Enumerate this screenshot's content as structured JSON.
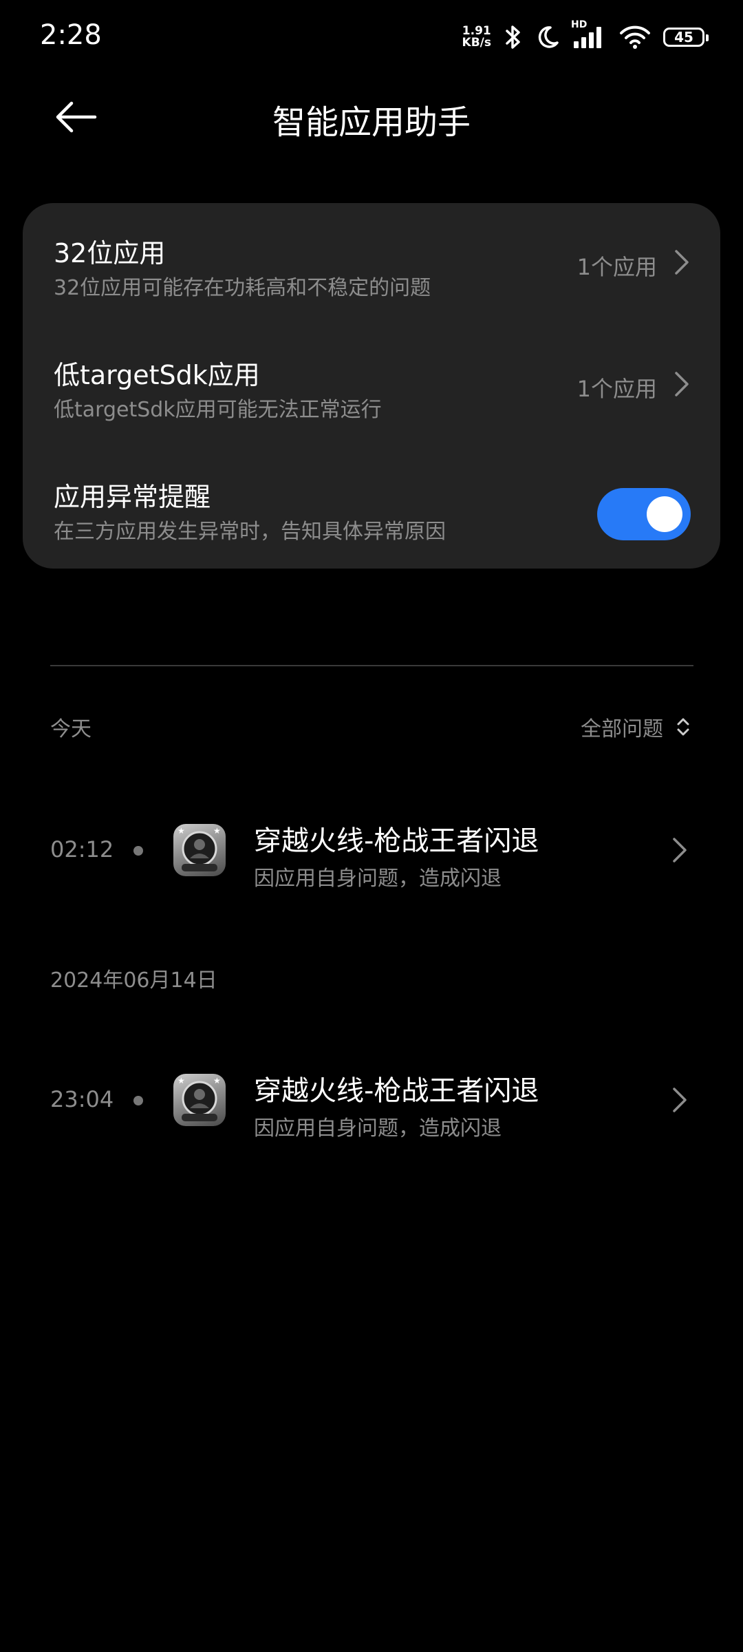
{
  "status_bar": {
    "time": "2:28",
    "net_speed_value": "1.91",
    "net_speed_unit": "KB/s",
    "signal_label": "HD",
    "battery": "45"
  },
  "header": {
    "title": "智能应用助手"
  },
  "settings": [
    {
      "title": "32位应用",
      "subtitle": "32位应用可能存在功耗高和不稳定的问题",
      "value": "1个应用"
    },
    {
      "title": "低targetSdk应用",
      "subtitle": "低targetSdk应用可能无法正常运行",
      "value": "1个应用"
    },
    {
      "title": "应用异常提醒",
      "subtitle": "在三方应用发生异常时，告知具体异常原因",
      "toggle_on": true
    }
  ],
  "history": {
    "today_label": "今天",
    "filter_label": "全部问题",
    "groups": [
      {
        "date": "今天",
        "events": [
          {
            "time": "02:12",
            "app_title": "穿越火线-枪战王者闪退",
            "reason": "因应用自身问题，造成闪退"
          }
        ]
      },
      {
        "date": "2024年06月14日",
        "events": [
          {
            "time": "23:04",
            "app_title": "穿越火线-枪战王者闪退",
            "reason": "因应用自身问题，造成闪退"
          }
        ]
      }
    ]
  },
  "colors": {
    "background": "#000000",
    "card": "#232323",
    "accent": "#277af7",
    "secondary_text": "#8d8d8d"
  }
}
